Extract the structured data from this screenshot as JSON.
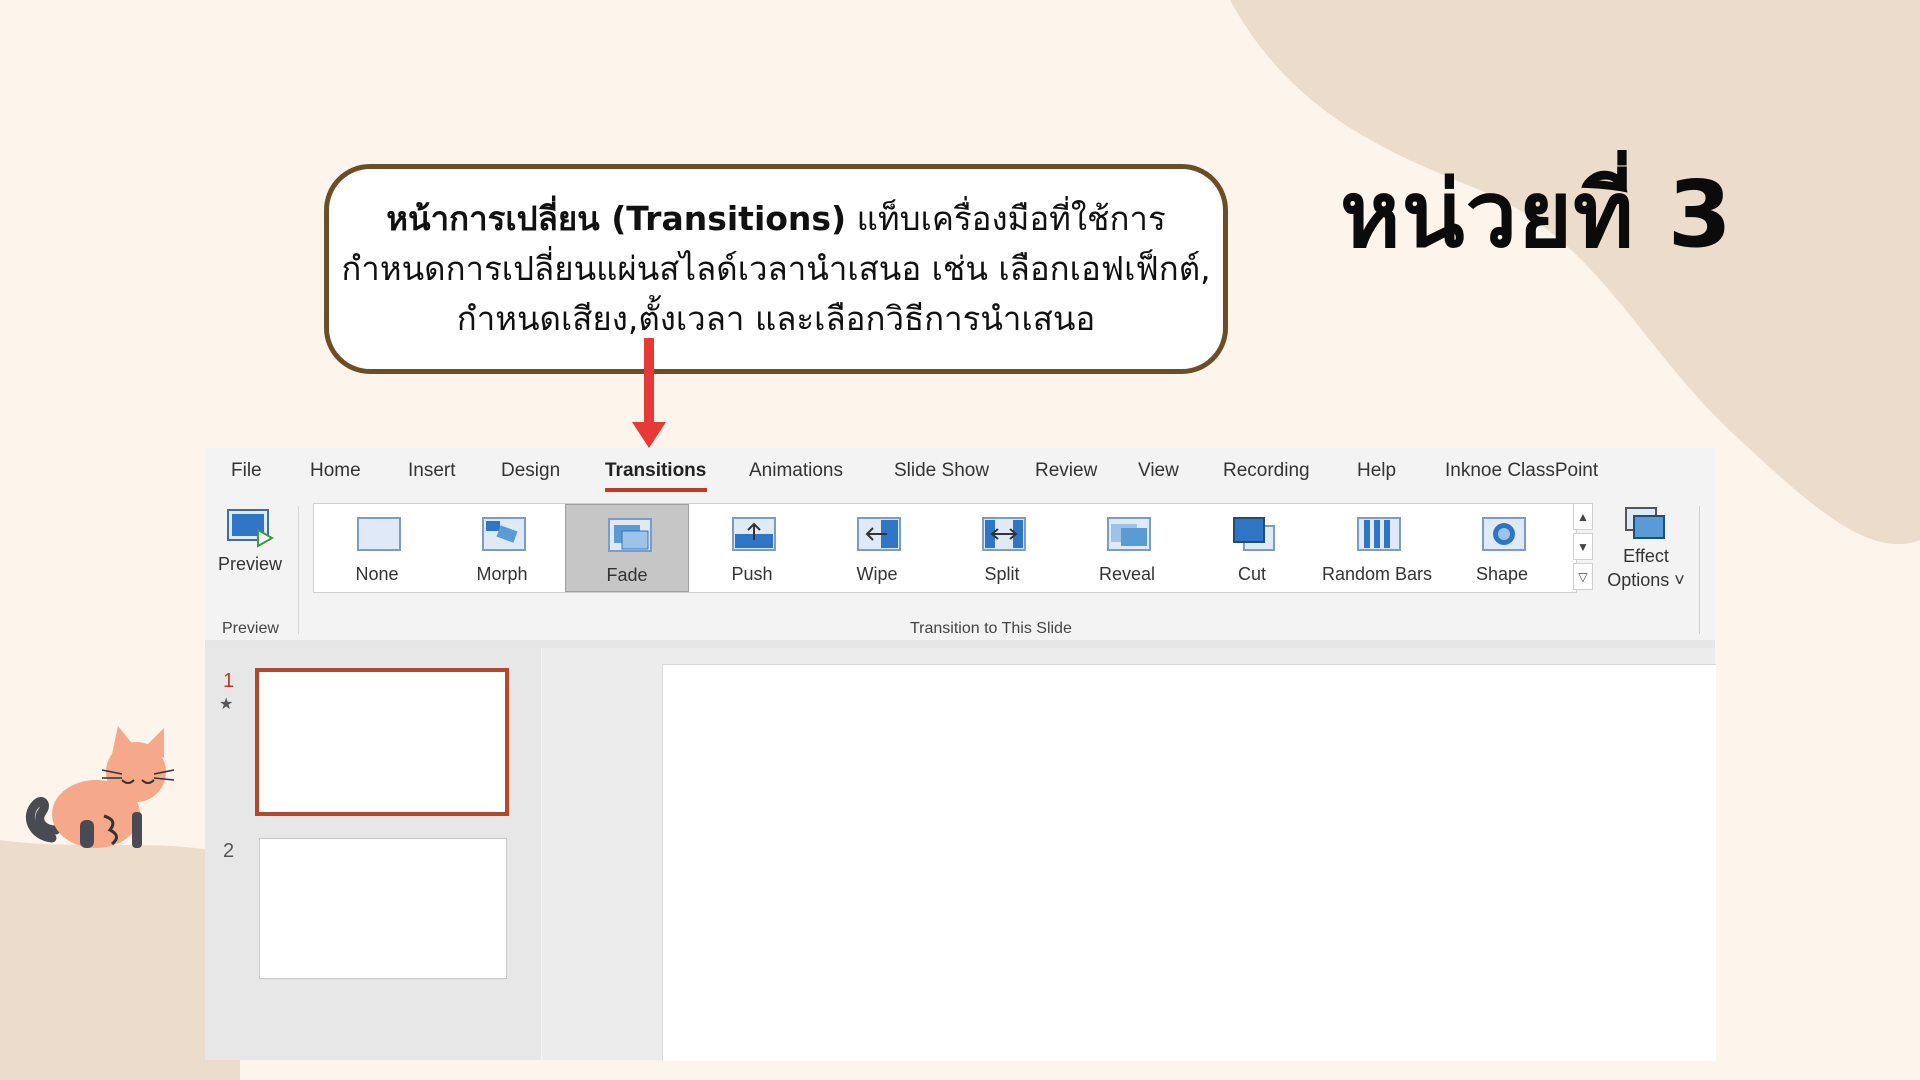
{
  "title": "หน่วยที่ 3",
  "callout": {
    "bold": "หน้าการเปลี่ยน (Transitions)",
    "line1_rest": " แท็บเครื่องมือที่ใช้การ",
    "line2": "กำหนดการเปลี่ยนแผ่นสไลด์เวลานำเสนอ เช่น เลือกเอฟเฟ็กต์,",
    "line3": "กำหนดเสียง,ตั้งเวลา และเลือกวิธีการนำเสนอ"
  },
  "colors": {
    "background": "#fdf4ec",
    "blob": "#ecdccc",
    "callout_border": "#6b4e26",
    "arrow": "#e63a36",
    "accent": "#c0392b"
  },
  "menu": [
    "File",
    "Home",
    "Insert",
    "Design",
    "Transitions",
    "Animations",
    "Slide Show",
    "Review",
    "View",
    "Recording",
    "Help",
    "Inknoe ClassPoint"
  ],
  "active_tab": "Transitions",
  "ribbon": {
    "preview_label": "Preview",
    "preview_group": "Preview",
    "transitions_group": "Transition to This Slide",
    "transitions": [
      "None",
      "Morph",
      "Fade",
      "Push",
      "Wipe",
      "Split",
      "Reveal",
      "Cut",
      "Random Bars",
      "Shape"
    ],
    "selected_transition": "Fade",
    "effect_options_line1": "Effect",
    "effect_options_line2": "Options"
  },
  "slides": {
    "num1": "1",
    "num2": "2",
    "star": "★",
    "selected": "1"
  }
}
